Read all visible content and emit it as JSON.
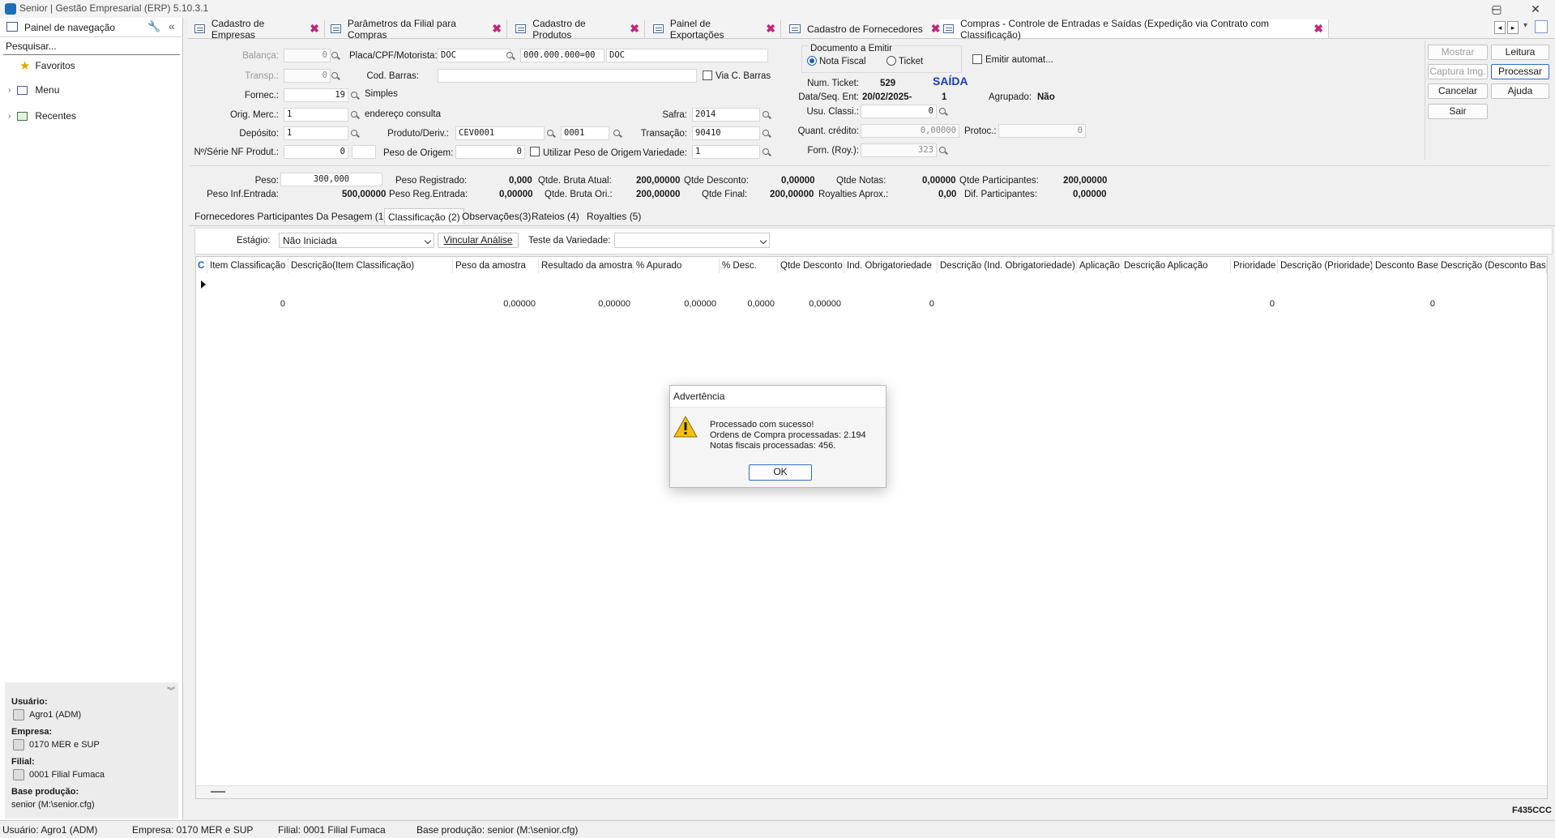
{
  "window": {
    "title": "Senior | Gestão Empresarial (ERP) 5.10.3.1",
    "minimize": "─",
    "maximize": "▢",
    "close": "✕"
  },
  "nav": {
    "title": "Painel de navegação",
    "search_placeholder": "Pesquisar...",
    "items": [
      {
        "label": "Favoritos",
        "icon": "star-icon"
      },
      {
        "label": "Menu",
        "icon": "menu-icon"
      },
      {
        "label": "Recentes",
        "icon": "recent-icon"
      }
    ],
    "footer": {
      "user_label": "Usuário:",
      "user_value": "Agro1 (ADM)",
      "company_label": "Empresa:",
      "company_value": "0170 MER e SUP",
      "branch_label": "Filial:",
      "branch_value": "0001 Filial Fumaca",
      "base_label": "Base produção:",
      "base_value": "senior (M:\\senior.cfg)"
    }
  },
  "tabs": [
    {
      "label": "Cadastro de Empresas"
    },
    {
      "label": "Parâmetros da Filial para Compras"
    },
    {
      "label": "Cadastro de Produtos"
    },
    {
      "label": "Painel de Exportações"
    },
    {
      "label": "Cadastro de Fornecedores"
    },
    {
      "label": "Compras - Controle de Entradas e Saídas (Expedição via Contrato com Classificação)"
    }
  ],
  "form": {
    "balanca_label": "Balança:",
    "balanca_value": "0",
    "placa_label": "Placa/CPF/Motorista:",
    "placa_value": "DOC",
    "cpf_value": "000.000.000=00",
    "motorista_value": "DOC",
    "transp_label": "Transp.:",
    "transp_value": "0",
    "codbarras_label": "Cod. Barras:",
    "viacbarras_label": "Via C. Barras",
    "fornec_label": "Fornec.:",
    "fornec_value": "19",
    "fornec_desc": "Simples",
    "origmerc_label": "Orig. Merc.:",
    "origmerc_value": "1",
    "origmerc_desc": "endereço consulta",
    "safra_label": "Safra:",
    "safra_value": "2014",
    "deposito_label": "Depósito:",
    "deposito_value": "1",
    "produto_label": "Produto/Deriv.:",
    "produto_value": "CEV0001",
    "deriv_value": "0001",
    "transacao_label": "Transação:",
    "transacao_value": "90410",
    "nfprodut_label": "Nº/Série NF Produt.:",
    "nfprodut_value": "0",
    "pesoorigem_label": "Peso de Origem:",
    "pesoorigem_value": "0",
    "utilizarpeso_label": "Utilizar Peso de Origem",
    "variedade_label": "Variedade:",
    "variedade_value": "1",
    "doc_group_label": "Documento a Emitir",
    "nota_fiscal_label": "Nota Fiscal",
    "ticket_label": "Ticket",
    "emitir_label": "Emitir automat...",
    "numticket_label": "Num. Ticket:",
    "numticket_value": "529",
    "saida_label": "SAÍDA",
    "dataseq_label": "Data/Seq. Ent:",
    "dataseq_value": "20/02/2025-",
    "seq_value": "1",
    "agrupado_label": "Agrupado:",
    "agrupado_value": "Não",
    "usuclassi_label": "Usu. Classi.:",
    "usuclassi_value": "0",
    "quantcredito_label": "Quant. crédito:",
    "quantcredito_value": "0,00000",
    "protoc_label": "Protoc.:",
    "protoc_value": "0",
    "fornroy_label": "Forn. (Roy.):",
    "fornroy_value": "323"
  },
  "buttons": {
    "mostrar": "Mostrar",
    "leitura": "Leitura",
    "captura": "Captura Img.",
    "processar": "Processar",
    "cancelar": "Cancelar",
    "ajuda": "Ajuda",
    "sair": "Sair"
  },
  "summary": {
    "peso_label": "Peso:",
    "peso_value": "300,000",
    "pesoinf_label": "Peso Inf.Entrada:",
    "pesoinf_value": "500,00000",
    "pesoreg_label": "Peso Registrado:",
    "pesoreg_value": "0,000",
    "pesoregent_label": "Peso Reg.Entrada:",
    "pesoregent_value": "0,00000",
    "brutaatual_label": "Qtde. Bruta Atual:",
    "brutaatual_value": "200,00000",
    "brutaori_label": "Qtde. Bruta Ori.:",
    "brutaori_value": "200,00000",
    "desconto_label": "Qtde Desconto:",
    "desconto_value": "0,00000",
    "final_label": "Qtde Final:",
    "final_value": "200,00000",
    "notas_label": "Qtde Notas:",
    "notas_value": "0,00000",
    "royalties_label": "Royalties Aprox.:",
    "royalties_value": "0,00",
    "participantes_label": "Qtde Participantes:",
    "participantes_value": "200,00000",
    "difpart_label": "Dif. Participantes:",
    "difpart_value": "0,00000"
  },
  "subtabs": [
    {
      "label": "Fornecedores Participantes Da Pesagem (1)"
    },
    {
      "label": "Classificação (2)"
    },
    {
      "label": "Observações(3)"
    },
    {
      "label": "Rateios (4)"
    },
    {
      "label": "Royalties (5)"
    }
  ],
  "classif": {
    "estagio_label": "Estágio:",
    "estagio_value": "Não Iniciada",
    "vincular_button": "Vincular Análise",
    "teste_label": "Teste da Variedade:",
    "teste_value": ""
  },
  "grid": {
    "corner": "C",
    "headers": [
      "Item Classificação",
      "Descrição(Item Classificação)",
      "Peso da amostra",
      "Resultado da amostra",
      "% Apurado",
      "% Desc.",
      "Qtde Desconto",
      "Ind. Obrigatoriedade",
      "Descrição (Ind. Obrigatoriedade)",
      "Aplicação",
      "Descrição Aplicação",
      "Prioridade",
      "Descrição (Prioridade)",
      "Desconto Base",
      "Descrição (Desconto Base)"
    ],
    "row": [
      "0",
      "",
      "0,00000",
      "0,00000",
      "0,00000",
      "0,0000",
      "0,00000",
      "0",
      "",
      "",
      "",
      "0",
      "",
      "0",
      ""
    ]
  },
  "form_code": "F435CCC",
  "statusbar": {
    "user": "Usuário: Agro1 (ADM)",
    "company": "Empresa: 0170 MER e SUP",
    "branch": "Filial: 0001 Filial Fumaca",
    "base": "Base produção: senior (M:\\senior.cfg)"
  },
  "dialog": {
    "title": "Advertência",
    "line1": "Processado com sucesso!",
    "line2": "Ordens de Compra processadas: 2.194",
    "line3": "Notas fiscais processadas: 456.",
    "ok": "OK"
  }
}
